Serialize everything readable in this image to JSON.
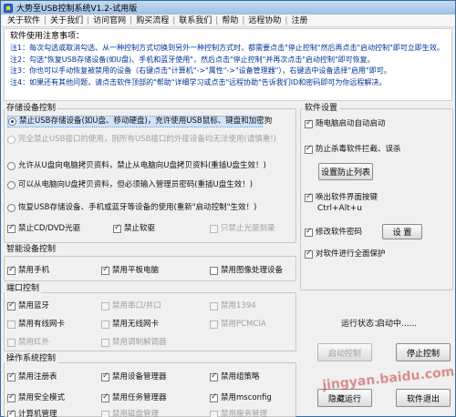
{
  "window": {
    "title": "大势至USB控制系统V1.2-试用版"
  },
  "menu": [
    "关于软件",
    "关于我们",
    "访问官网",
    "购买流程",
    "联系我们",
    "帮助",
    "远程协助",
    "注册"
  ],
  "notes": {
    "heading": "软件使用注意事项：",
    "lines": [
      "注1：每次勾选或取消勾选、从一种控制方式切换到另外一种控制方式时，都需要点击\"停止控制\"然后再点击\"启动控制\"即可立即生效。",
      "注2：勾选\"恢复USB存储设备(如U盘)、手机和蓝牙使用\"，然后点击\"停止控制\"并再次点击\"启动控制\"即可恢复。",
      "注3：你也可以手动恢复被禁用的设备（右键点击\"计算机\"->\"属性\"->\"设备管理器\"），右键选中设备选择\"启用\"即可。",
      "注4：如果还有其他问题，请点击软件顶部的\"帮助\"详细学习或点击\"远程协助\"告诉我们ID和密码即可为你远程解决。"
    ]
  },
  "storage": {
    "title": "存储设备控制",
    "opt1": "禁止USB存储设备(如U盘、移动硬盘)，充许使用USB鼠标、键盘和加密狗",
    "opt2": "完全禁止USB接口的使用，则所有USB接口的外接设备均无法使用(请慎重!)",
    "opt3": "允许从U盘向电脑拷贝资料，禁止从电脑向U盘拷贝资料(重插U盘生效！)",
    "opt4": "可以从电脑向U盘拷贝资料，但必须输入管理员密码(重插U盘生效！)",
    "opt5": "恢复USB存储设备、手机或蓝牙等设备的使用(重新\"启动控制\"生效！)",
    "cd": "禁止CD/DVD光驱",
    "floppy": "禁止软驱",
    "cdburn": "只禁止光驱刻录"
  },
  "smart": {
    "title": "智能设备控制",
    "phone": "禁用手机",
    "tablet": "禁用平板电脑",
    "imaging": "禁用图像处理设备"
  },
  "ports": {
    "title": "端口控制",
    "bluetooth": "禁用蓝牙",
    "serial": "禁用串口/并口",
    "ieee1394": "禁用1394",
    "wired": "禁用有线网卡",
    "wireless": "禁用无线网卡",
    "pcmcia": "禁用PCMCIA",
    "infrared": "禁用红外",
    "modem": "禁用调制解调器"
  },
  "os": {
    "title": "操作系统控制",
    "registry": "禁用注册表",
    "devmgr": "禁用设备管理器",
    "gpedit": "禁用组策略",
    "safemode": "禁用安全模式",
    "taskmgr": "禁用任务管理器",
    "msconfig": "禁用msconfig",
    "row3a": "计算机管理",
    "row3b": "禁用磁盘管理",
    "row3c": "禁用服务管理"
  },
  "settings": {
    "title": "软件设置",
    "autostart": "随电脑启动自动启动",
    "antikill": "防止杀毒软件拦截、误杀",
    "antikill_btn": "设置防止列表",
    "hotkey_line1": "唤出软件界面按键",
    "hotkey_line2": "Ctrl+Alt+u",
    "password": "修改软件密码",
    "password_btn": "设 置",
    "protect": "对软件进行全面保护"
  },
  "status": {
    "label": "运行状态：",
    "value": "启动中......"
  },
  "buttons": {
    "start": "启动控制",
    "stop": "停止控制",
    "hide": "隐藏运行",
    "exit": "软件退出"
  },
  "watermark": "jingyan.baidu.com"
}
